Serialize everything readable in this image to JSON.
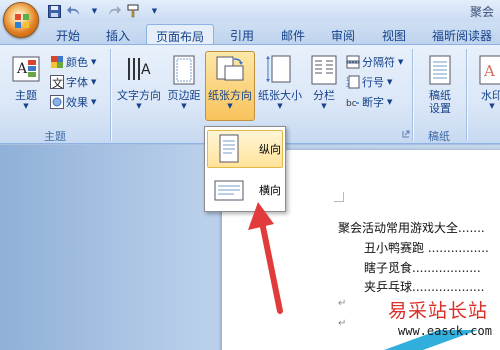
{
  "window": {
    "title": "聚会"
  },
  "tabs": [
    {
      "label": "开始",
      "active": false
    },
    {
      "label": "插入",
      "active": false
    },
    {
      "label": "页面布局",
      "active": true
    },
    {
      "label": "引用",
      "active": false
    },
    {
      "label": "邮件",
      "active": false
    },
    {
      "label": "审阅",
      "active": false
    },
    {
      "label": "视图",
      "active": false
    },
    {
      "label": "福昕阅读器",
      "active": false
    }
  ],
  "ribbon": {
    "theme_group": {
      "label": "主题",
      "theme_button": "主题",
      "colors": "颜色",
      "fonts": "字体",
      "effects": "效果"
    },
    "page_setup_group": {
      "text_direction": "文字方向",
      "margins": "页边距",
      "orientation": "纸张方向",
      "size": "纸张大小",
      "columns": "分栏",
      "breaks": "分隔符",
      "line_numbers": "行号",
      "hyphenation": "断字"
    },
    "manuscript_group": {
      "label": "稿纸",
      "button": "稿纸\n设置",
      "button_line1": "稿纸",
      "button_line2": "设置"
    },
    "watermark_partial": "水印"
  },
  "orientation_menu": {
    "portrait": "纵向",
    "landscape": "横向"
  },
  "document": {
    "lines": [
      "聚会活动常用游戏大全.......",
      "丑小鸭赛跑 ................",
      "瞎子觅食..................",
      "夹乒乓球..................."
    ]
  },
  "watermark": {
    "site_name": "易采站长站",
    "url": "www.easck.com"
  },
  "colors": {
    "ribbon_bg": "#dbe7f7",
    "tab_text": "#15428b",
    "pressed": "#f8c35c",
    "arrow_red": "#e23b3b",
    "watermark_red": "#d9302a"
  }
}
